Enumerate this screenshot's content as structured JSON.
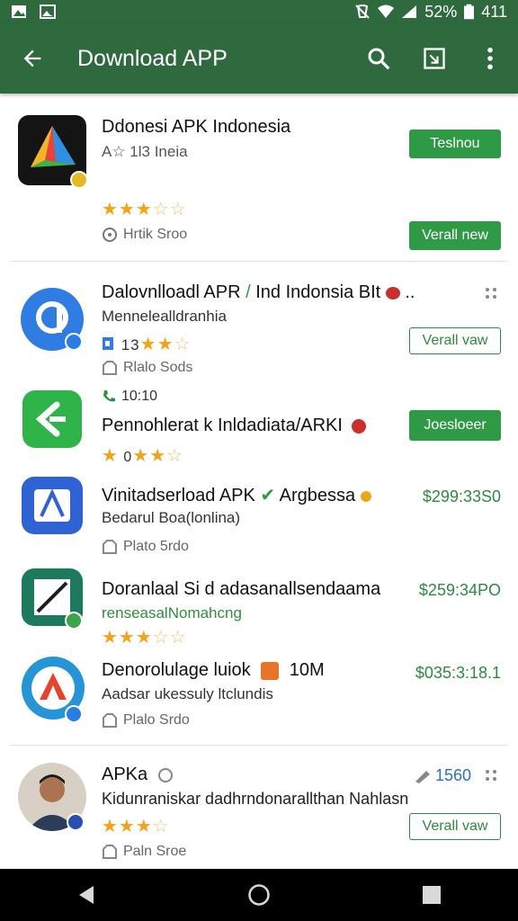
{
  "status_bar": {
    "battery": "52%",
    "time": "411",
    "left_icons": [
      "photo-icon",
      "image-icon"
    ],
    "right_icons": [
      "mute-icon",
      "wifi-icon",
      "signal-icon",
      "battery-icon"
    ]
  },
  "app_bar": {
    "title": "Download APP",
    "color": "#2f6a3f"
  },
  "items": [
    {
      "title": "Ddonesi APK Indonesia",
      "subtitle": "A☆ 1l3 Ineia",
      "meta": "Hrtik Sroo",
      "button_top": "Teslnou",
      "button_bottom": "Verall new"
    },
    {
      "title": "Dalovnlloadl APR",
      "title_extra": "Ind Indonsia BIt",
      "subtitle": "Mennelealldranhia",
      "meta": "Rlalo Sods",
      "button": "Verall vaw"
    },
    {
      "title": "Pennohlerat k Inldadiata/ARKI",
      "top_label": "10:10",
      "button": "Joesloeer"
    },
    {
      "title": "Vinitadserload APK",
      "title_extra": "Argbessa",
      "subtitle": "Bedarul Boa(lonlina)",
      "meta": "Plato 5rdo",
      "price": "$299:33S0"
    },
    {
      "title": "Doranlaal Si d adasanallsendaama",
      "subtitle": "renseasalNomahcng",
      "price": "$259:34PO"
    },
    {
      "title": "Denorolulage luiok",
      "title_extra": "10M",
      "subtitle": "Aadsar ukessuly ltclundis",
      "meta": "Plalo Srdo",
      "price": "$035:3:18.1"
    },
    {
      "title": "APKa",
      "subtitle": "Kidunraniskar dadhrndonarallthan Nahlasn",
      "meta": "Paln Sroe",
      "count": "1560",
      "button": "Verall vaw"
    }
  ],
  "colors": {
    "primary": "#2f6a3f",
    "button": "#2e9a45",
    "star": "#f2a21b",
    "price": "#2e8a3e"
  }
}
